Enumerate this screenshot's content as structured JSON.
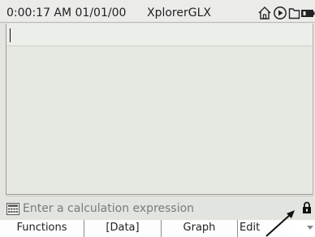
{
  "status_bar": {
    "clock": "0:00:17 AM 01/01/00",
    "device_name": "XplorerGLX",
    "icons": [
      "home-icon",
      "play-icon",
      "folder-icon",
      "battery-icon"
    ]
  },
  "calculator": {
    "expression_value": "",
    "placeholder": "Enter a calculation expression",
    "calc_icon": "calculator-icon",
    "lock_icon": "lock-icon"
  },
  "softkeys": {
    "functions": "Functions",
    "data": "[Data]",
    "graph": "Graph",
    "edit": "Edit"
  },
  "colors": {
    "background": "#e4e5e1",
    "expression_line": "#eceee9",
    "placeholder_text": "#7a7b78"
  }
}
